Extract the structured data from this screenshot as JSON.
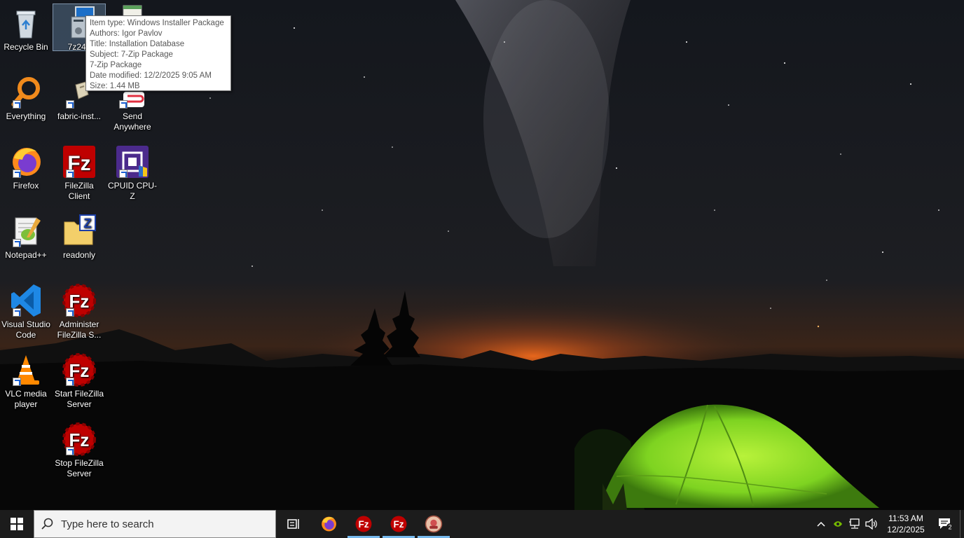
{
  "desktop": {
    "icons": {
      "recycle_bin": "Recycle Bin",
      "sevenzip_installer": "7z240",
      "everything": "Everything",
      "fabric_installer": "fabric-inst...",
      "send_anywhere": "Send Anywhere",
      "firefox": "Firefox",
      "filezilla_client": "FileZilla Client",
      "cpuz": "CPUID CPU-Z",
      "notepadpp": "Notepad++",
      "readonly": "readonly",
      "vscode": "Visual Studio Code",
      "admin_filezilla": "Administer FileZilla S...",
      "vlc": "VLC media player",
      "start_filezilla": "Start FileZilla Server",
      "stop_filezilla": "Stop FileZilla Server"
    }
  },
  "tooltip": {
    "item_type": "Item type: Windows Installer Package",
    "authors": "Authors: Igor Pavlov",
    "title": "Title: Installation Database",
    "subject": "Subject: 7-Zip Package",
    "comment": "7-Zip Package",
    "date_modified": "Date modified: 12/2/2025 9:05 AM",
    "size": "Size: 1.44 MB"
  },
  "taskbar": {
    "search_placeholder": "Type here to search",
    "clock_time": "11:53 AM",
    "clock_date": "12/2/2025",
    "notification_count": "2"
  },
  "colors": {
    "taskbar_bg": "#1c1c1c",
    "active_indicator": "#76b9ed",
    "tent_green": "#7ed321",
    "horizon_glow": "#e8641e"
  }
}
